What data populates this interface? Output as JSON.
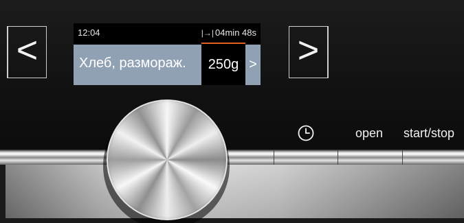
{
  "navigation": {
    "prev_label": "<",
    "next_label": ">"
  },
  "display": {
    "clock": "12:04",
    "timer_icon": "timer-end-icon",
    "timer_icon_glyph": "|→|",
    "timer": "04min 48s",
    "program_name": "Хлеб, размораж.",
    "weight": "250g",
    "more_arrow": ">",
    "colors": {
      "program_bar": "#8fa1b2",
      "accent": "#e0641e"
    }
  },
  "buttons": {
    "timer_icon": "clock-icon",
    "open_label": "open",
    "start_stop_label": "start/stop"
  }
}
